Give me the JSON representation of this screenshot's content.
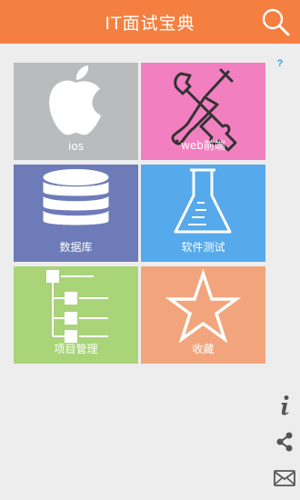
{
  "header": {
    "title": "IT面试宝典",
    "background": "#f47f40"
  },
  "tiles": [
    {
      "label": "ios",
      "color": "#b9bbbd",
      "icon": "apple-icon"
    },
    {
      "label": "web前端",
      "color": "#f27fc0",
      "icon": "tools-icon"
    },
    {
      "label": "数据库",
      "color": "#6d7bb8",
      "icon": "database-icon"
    },
    {
      "label": "软件测试",
      "color": "#56a9ea",
      "icon": "flask-icon"
    },
    {
      "label": "项目管理",
      "color": "#a9d478",
      "icon": "tree-icon"
    },
    {
      "label": "收藏",
      "color": "#f2a57c",
      "icon": "star-icon"
    }
  ],
  "side": {
    "help_badge": "?",
    "icons": [
      "info-icon",
      "share-icon",
      "mail-icon"
    ]
  }
}
